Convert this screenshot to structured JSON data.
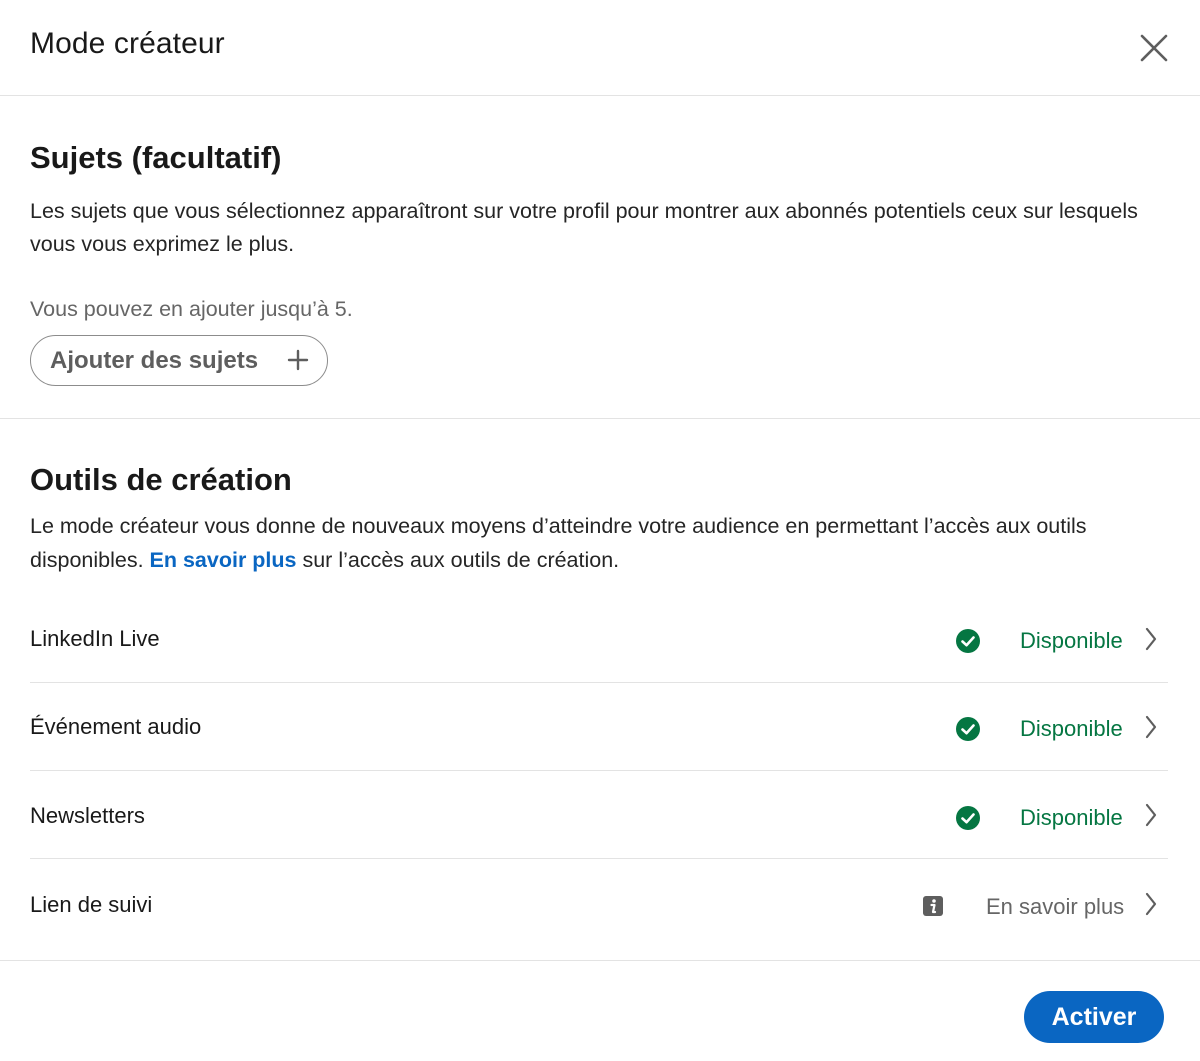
{
  "header": {
    "title": "Mode créateur"
  },
  "topics": {
    "title": "Sujets (facultatif)",
    "description": "Les sujets que vous sélectionnez apparaîtront sur votre profil pour montrer aux abonnés potentiels ceux sur lesquels vous vous exprimez le plus.",
    "hint": "Vous pouvez en ajouter jusqu’à 5.",
    "add_label": "Ajouter des sujets"
  },
  "tools": {
    "title": "Outils de création",
    "desc_before": "Le mode créateur vous donne de nouveaux moyens d’atteindre votre audience en permettant l’accès aux outils disponibles. ",
    "desc_link": "En savoir plus",
    "desc_after": " sur l’accès aux outils de création.",
    "items": [
      {
        "name": "LinkedIn Live",
        "status": "Disponible",
        "icon": "check-circle-icon"
      },
      {
        "name": "Événement audio",
        "status": "Disponible",
        "icon": "check-circle-icon"
      },
      {
        "name": "Newsletters",
        "status": "Disponible",
        "icon": "check-circle-icon"
      },
      {
        "name": "Lien de suivi",
        "status": "En savoir plus",
        "icon": "info-icon"
      }
    ]
  },
  "footer": {
    "activate_label": "Activer"
  },
  "colors": {
    "primary": "#0a66c2",
    "success": "#057642",
    "muted": "#666666"
  }
}
